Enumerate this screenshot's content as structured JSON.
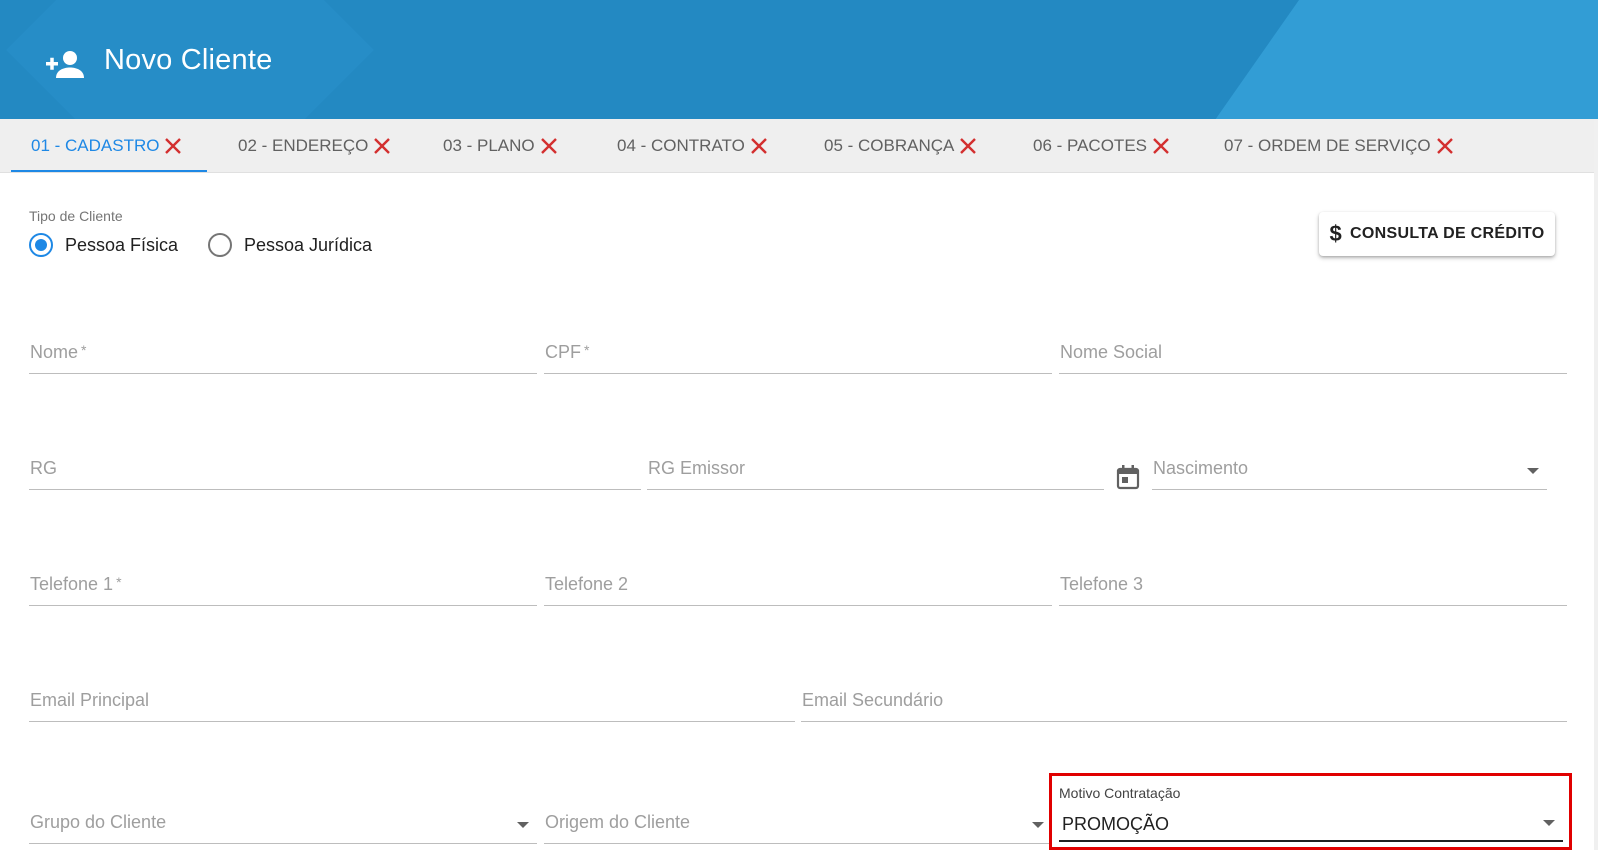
{
  "header": {
    "title": "Novo Cliente",
    "icon": "person-add-icon"
  },
  "tabs": [
    {
      "label": "01 - CADASTRO",
      "active": true
    },
    {
      "label": "02 - ENDEREÇO",
      "active": false
    },
    {
      "label": "03 - PLANO",
      "active": false
    },
    {
      "label": "04 - CONTRATO",
      "active": false
    },
    {
      "label": "05 - COBRANÇA",
      "active": false
    },
    {
      "label": "06 - PACOTES",
      "active": false
    },
    {
      "label": "07 - ORDEM DE SERVIÇO",
      "active": false
    }
  ],
  "tipo_cliente": {
    "label": "Tipo de Cliente",
    "options": [
      "Pessoa Física",
      "Pessoa Jurídica"
    ],
    "selected": "Pessoa Física"
  },
  "credit_button": {
    "icon": "dollar-icon",
    "label": "CONSULTA DE CRÉDITO"
  },
  "fields": {
    "nome": {
      "label": "Nome",
      "required_mark": "*"
    },
    "cpf": {
      "label": "CPF",
      "required_mark": "*"
    },
    "nome_social": {
      "label": "Nome Social"
    },
    "rg": {
      "label": "RG"
    },
    "rg_emissor": {
      "label": "RG Emissor"
    },
    "nascimento": {
      "label": "Nascimento",
      "icon": "calendar-icon"
    },
    "telefone1": {
      "label": "Telefone 1",
      "required_mark": "*"
    },
    "telefone2": {
      "label": "Telefone 2"
    },
    "telefone3": {
      "label": "Telefone 3"
    },
    "email_principal": {
      "label": "Email Principal"
    },
    "email_secundario": {
      "label": "Email Secundário"
    },
    "grupo_cliente": {
      "label": "Grupo do Cliente"
    },
    "origem_cliente": {
      "label": "Origem do Cliente"
    },
    "motivo_contratacao": {
      "label": "Motivo Contratação",
      "value": "PROMOÇÃO"
    }
  },
  "colors": {
    "header": "#2389c2",
    "accent": "#1e88e5",
    "tab_close": "#d32f2f",
    "highlight": "#e00000"
  }
}
